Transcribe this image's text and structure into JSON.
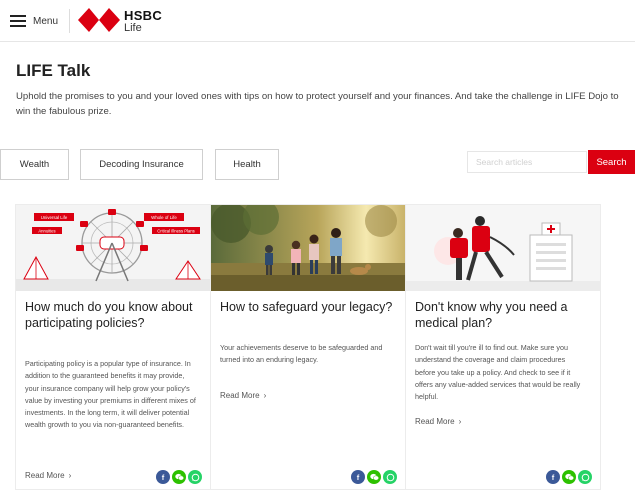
{
  "header": {
    "menu_label": "Menu",
    "logo_name": "HSBC",
    "logo_sub": "Life",
    "brand_color": "#db0011"
  },
  "page": {
    "title": "LIFE Talk",
    "intro": "Uphold the promises to you and your loved ones with tips on how to protect yourself and your finances. And take the challenge in LIFE Dojo to win the fabulous prize."
  },
  "filters": [
    {
      "label": "Wealth"
    },
    {
      "label": "Decoding Insurance"
    },
    {
      "label": "Health"
    }
  ],
  "search": {
    "placeholder": "Search articles",
    "button_label": "Search"
  },
  "cards": [
    {
      "title": "How much do you know about participating policies?",
      "description": "Participating policy is a popular type of insurance. In addition to the guaranteed benefits it may provide, your insurance company will help grow your policy's value by investing your premiums in different mixes of investments. In the long term, it will deliver potential wealth growth to you via non-guaranteed benefits.",
      "read_more": "Read More",
      "image_icon": "ferris-wheel-illustration",
      "image_labels": [
        "Universal Life",
        "Annuities",
        "Whole of Life",
        "Critical Illness Plans"
      ]
    },
    {
      "title": "How to safeguard your legacy?",
      "description": "Your achievements deserve to be safeguarded and turned into an enduring legacy.",
      "read_more": "Read More",
      "image_icon": "family-running-photo"
    },
    {
      "title": "Don't know why you need a medical plan?",
      "description": "Don't wait till you're ill to find out. Make sure you understand the coverage and claim procedures before you take up a policy. And check to see if it offers any value-added services that would be really helpful.",
      "read_more": "Read More",
      "image_icon": "hospital-illustration"
    }
  ],
  "share_icons": [
    {
      "icon": "facebook-icon",
      "color": "#3b5998"
    },
    {
      "icon": "wechat-icon",
      "color": "#2dc100"
    },
    {
      "icon": "whatsapp-icon",
      "color": "#25d366"
    }
  ]
}
